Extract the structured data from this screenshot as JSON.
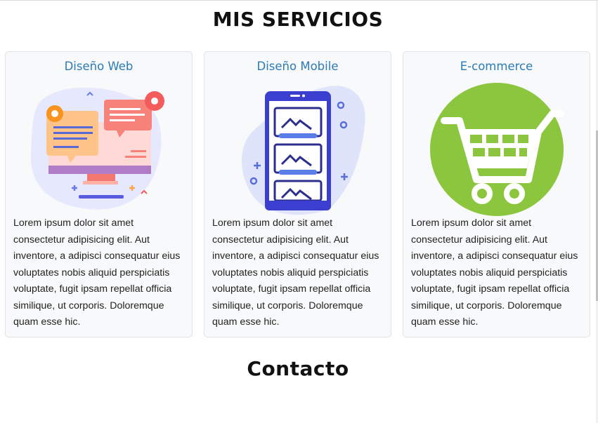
{
  "sections": {
    "services_title": "MIS SERVICIOS",
    "contact_title": "Contacto"
  },
  "cards": [
    {
      "title": "Diseño Web",
      "illustration": "web-design-illustration",
      "text": "Lorem ipsum dolor sit amet consectetur adipisicing elit. Aut inventore, a adipisci consequatur eius voluptates nobis aliquid perspiciatis voluptate, fugit ipsam repellat officia similique, ut corporis. Doloremque quam esse hic."
    },
    {
      "title": "Diseño Mobile",
      "illustration": "mobile-design-illustration",
      "text": "Lorem ipsum dolor sit amet consectetur adipisicing elit. Aut inventore, a adipisci consequatur eius voluptates nobis aliquid perspiciatis voluptate, fugit ipsam repellat officia similique, ut corporis. Doloremque quam esse hic."
    },
    {
      "title": "E-commerce",
      "illustration": "shopping-cart-icon",
      "text": "Lorem ipsum dolor sit amet consectetur adipisicing elit. Aut inventore, a adipisci consequatur eius voluptates nobis aliquid perspiciatis voluptate, fugit ipsam repellat officia similique, ut corporis. Doloremque quam esse hic."
    }
  ],
  "colors": {
    "card_title": "#2a7bb7",
    "card_background": "#f8f9fa",
    "card_border": "#dfe3e7",
    "cart_green": "#8cc63f"
  }
}
